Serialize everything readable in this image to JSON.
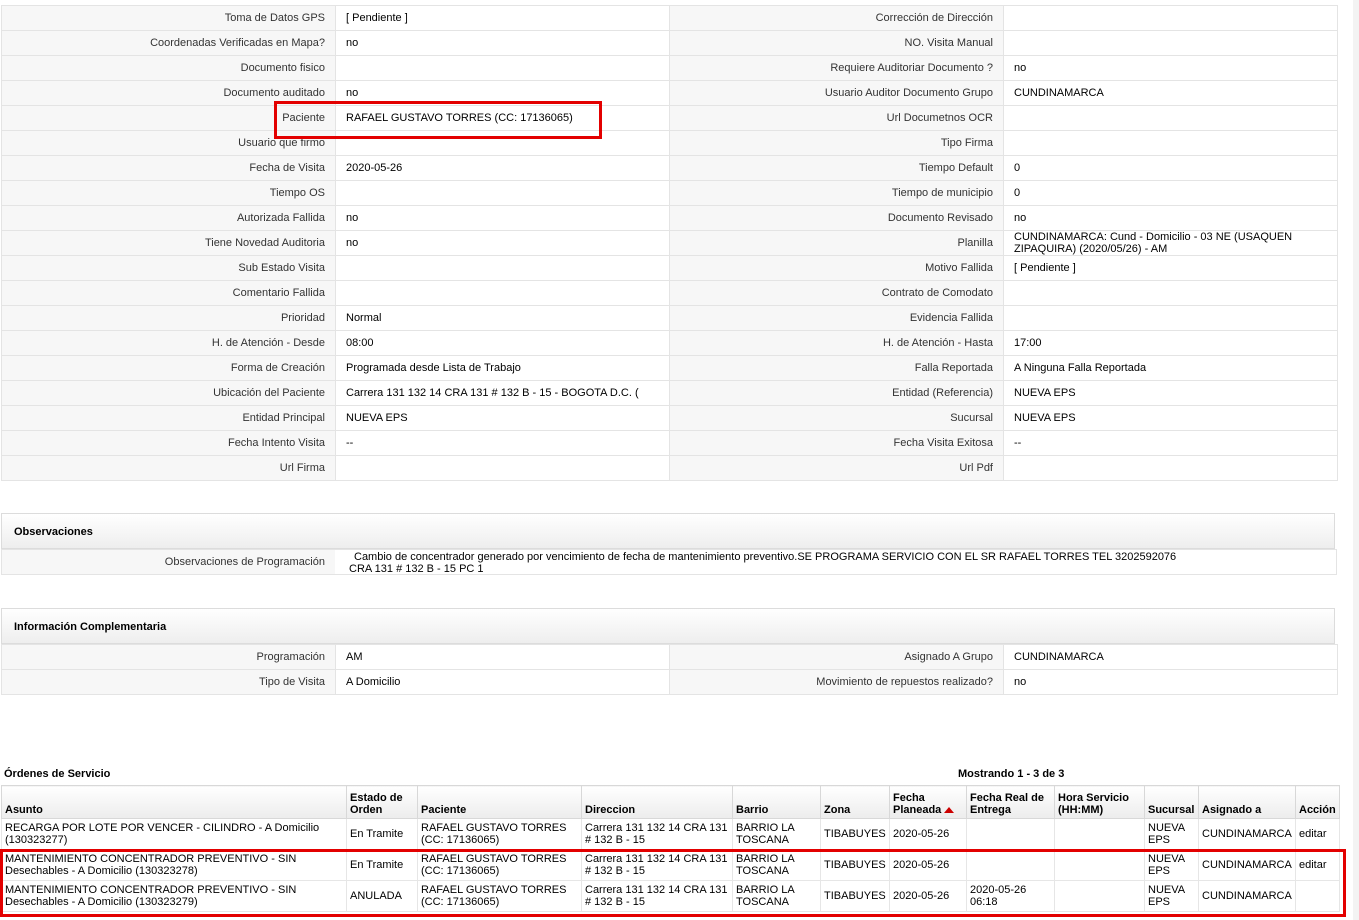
{
  "details": {
    "rows": [
      {
        "l1": "Toma de Datos GPS",
        "v1": "[ Pendiente ]",
        "l2": "Corrección de Dirección",
        "v2": ""
      },
      {
        "l1": "Coordenadas Verificadas en Mapa?",
        "v1": " no",
        "l2": "NO. Visita Manual",
        "v2": ""
      },
      {
        "l1": "Documento fisico",
        "v1": "",
        "l2": "Requiere Auditoriar Documento ?",
        "v2": " no"
      },
      {
        "l1": "Documento auditado",
        "v1": " no",
        "l2": "Usuario Auditor Documento Grupo",
        "v2": "CUNDINAMARCA"
      },
      {
        "l1": "Paciente",
        "v1": "RAFAEL GUSTAVO TORRES (CC: 17136065)",
        "l2": "Url Documetnos OCR",
        "v2": ""
      },
      {
        "l1": "Usuario que firmo",
        "v1": "",
        "l2": "Tipo Firma",
        "v2": ""
      },
      {
        "l1": "Fecha de Visita",
        "v1": " 2020-05-26",
        "l2": "Tiempo Default",
        "v2": "0"
      },
      {
        "l1": "Tiempo OS",
        "v1": "",
        "l2": "Tiempo de municipio",
        "v2": "0"
      },
      {
        "l1": "Autorizada Fallida",
        "v1": " no",
        "l2": "Documento Revisado",
        "v2": " no"
      },
      {
        "l1": "Tiene Novedad Auditoria",
        "v1": " no",
        "l2": "Planilla",
        "v2": "CUNDINAMARCA: Cund - Domicilio - 03 NE (USAQUEN ZIPAQUIRA) (2020/05/26) - AM"
      },
      {
        "l1": "Sub Estado Visita",
        "v1": "",
        "l2": "Motivo Fallida",
        "v2": "[ Pendiente ]"
      },
      {
        "l1": "Comentario Fallida",
        "v1": "",
        "l2": "Contrato de Comodato",
        "v2": ""
      },
      {
        "l1": "Prioridad",
        "v1": "Normal",
        "l2": "Evidencia Fallida",
        "v2": ""
      },
      {
        "l1": "H. de Atención - Desde",
        "v1": "08:00",
        "l2": "H. de Atención - Hasta",
        "v2": "17:00"
      },
      {
        "l1": "Forma de Creación",
        "v1": "Programada desde Lista de Trabajo",
        "l2": "Falla Reportada",
        "v2": "A Ninguna Falla Reportada"
      },
      {
        "l1": "Ubicación del Paciente",
        "v1": "Carrera 131 132 14 CRA 131 # 132 B - 15 - BOGOTA D.C. (",
        "l2": "Entidad (Referencia)",
        "v2": "NUEVA EPS"
      },
      {
        "l1": "Entidad Principal",
        "v1": "NUEVA EPS",
        "l2": "Sucursal",
        "v2": "NUEVA EPS"
      },
      {
        "l1": "Fecha Intento Visita",
        "v1": " --",
        "l2": "Fecha Visita Exitosa",
        "v2": " --"
      },
      {
        "l1": "Url Firma",
        "v1": "",
        "l2": "Url Pdf",
        "v2": ""
      }
    ]
  },
  "observaciones": {
    "title": "Observaciones",
    "label": "Observaciones de Programación",
    "line1": "Cambio de concentrador generado por vencimiento de fecha de mantenimiento preventivo.SE PROGRAMA SERVICIO CON EL SR RAFAEL TORRES TEL 3202592076",
    "line2": "CRA 131 # 132 B - 15 PC 1"
  },
  "complementaria": {
    "title": "Información Complementaria",
    "rows": [
      {
        "l1": "Programación",
        "v1": "AM",
        "l2": "Asignado A Grupo",
        "v2": "CUNDINAMARCA"
      },
      {
        "l1": "Tipo de Visita",
        "v1": "A Domicilio",
        "l2": "Movimiento de repuestos realizado?",
        "v2": " no"
      }
    ]
  },
  "orders": {
    "title": "Órdenes de Servicio",
    "count": "Mostrando 1 - 3 de 3",
    "headers": [
      "Asunto",
      "Estado de Orden",
      "Paciente",
      "Direccion",
      "Barrio",
      "Zona",
      "Fecha Planeada",
      "Fecha Real de Entrega",
      "Hora Servicio (HH:MM)",
      "Sucursal",
      "Asignado a",
      "Acción"
    ],
    "rows": [
      [
        "RECARGA POR LOTE POR VENCER - CILINDRO - A Domicilio (130323277)",
        "En Tramite",
        "RAFAEL GUSTAVO TORRES (CC: 17136065)",
        "Carrera 131 132 14 CRA 131 # 132 B - 15",
        "BARRIO LA TOSCANA",
        "TIBABUYES",
        "2020-05-26",
        "",
        "",
        "NUEVA EPS",
        "CUNDINAMARCA",
        "editar"
      ],
      [
        "MANTENIMIENTO CONCENTRADOR PREVENTIVO - SIN Desechables - A Domicilio (130323278)",
        "En Tramite",
        "RAFAEL GUSTAVO TORRES (CC: 17136065)",
        "Carrera 131 132 14 CRA 131 # 132 B - 15",
        "BARRIO LA TOSCANA",
        "TIBABUYES",
        "2020-05-26",
        "",
        "",
        "NUEVA EPS",
        "CUNDINAMARCA",
        "editar"
      ],
      [
        "MANTENIMIENTO CONCENTRADOR PREVENTIVO - SIN Desechables - A Domicilio (130323279)",
        "ANULADA",
        "RAFAEL GUSTAVO TORRES (CC: 17136065)",
        "Carrera 131 132 14 CRA 131 # 132 B - 15",
        "BARRIO LA TOSCANA",
        "TIBABUYES",
        "2020-05-26",
        "2020-05-26 06:18",
        "",
        "NUEVA EPS",
        "CUNDINAMARCA",
        ""
      ]
    ]
  }
}
